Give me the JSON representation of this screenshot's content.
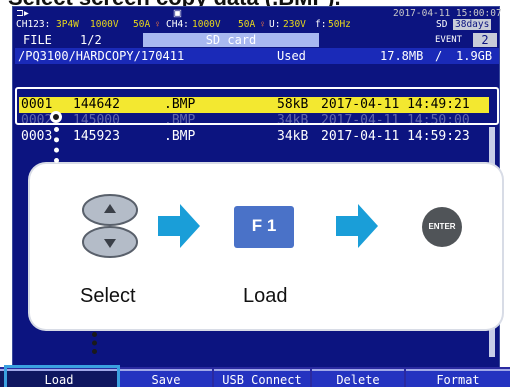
{
  "page": {
    "heading": "Select screen copy data (.BMP)."
  },
  "status": {
    "left_icon": "power-plug-icon",
    "center_icon": "sd-card-icon",
    "datetime": "2017-04-11 15:00:07",
    "channel_info": "CH123:",
    "wiring": "3P4W",
    "voltage_range": "1000V",
    "current_range": "50A",
    "ch4_label": "CH4:",
    "ch4_voltage": "1000V",
    "ch4_current": "50A",
    "u_label": "U:",
    "u_value": "230V",
    "f_label": "f:",
    "f_value": "50Hz",
    "sd_label": "SD",
    "sd_days": "38days",
    "event_label": "EVENT",
    "event_count": "2"
  },
  "tabs": {
    "file": "FILE",
    "page": "1/2",
    "media": "SD card"
  },
  "path_bar": {
    "path": "/PQ3100/HARDCOPY/170411",
    "used_label": "Used",
    "used_size": "17.8MB",
    "separator": "/",
    "total_size": "1.9GB"
  },
  "files": [
    {
      "no": "0001",
      "name": "144642",
      "ext": ".BMP",
      "size": "58kB",
      "timestamp": "2017-04-11 14:49:21",
      "selected": true
    },
    {
      "no": "0002",
      "name": "145000",
      "ext": ".BMP",
      "size": "34kB",
      "timestamp": "2017-04-11 14:50:00",
      "selected": false
    },
    {
      "no": "0003",
      "name": "145923",
      "ext": ".BMP",
      "size": "34kB",
      "timestamp": "2017-04-11 14:59:23",
      "selected": false
    }
  ],
  "instructions": {
    "step1_label": "Select",
    "step2_key": "F 1",
    "step2_label": "Load",
    "step3_key": "ENTER",
    "arrow_color": "#1a9ed8"
  },
  "function_keys": [
    "Load",
    "Save",
    "USB Connect",
    "Delete",
    "Format"
  ],
  "colors": {
    "screen": "#0c1480",
    "selected_row": "#f3e830",
    "tab": "#a8b8f0"
  }
}
